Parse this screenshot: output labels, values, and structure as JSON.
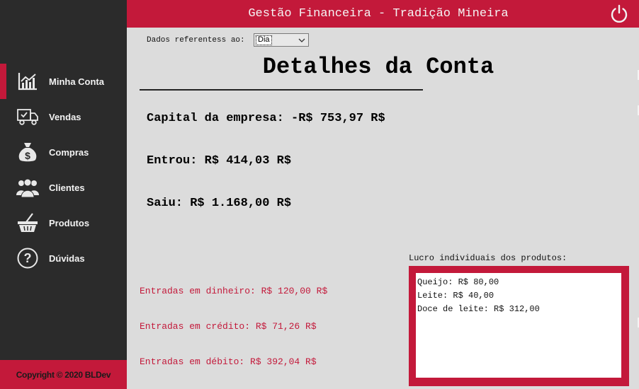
{
  "header": {
    "title": "Gestão Financeira - Tradição Mineira",
    "power_icon": "power-icon"
  },
  "sidebar": {
    "items": [
      {
        "label": "Minha Conta",
        "icon": "chart-icon",
        "active": true
      },
      {
        "label": "Vendas",
        "icon": "truck-icon",
        "active": false
      },
      {
        "label": "Compras",
        "icon": "money-bag-icon",
        "active": false
      },
      {
        "label": "Clientes",
        "icon": "users-icon",
        "active": false
      },
      {
        "label": "Produtos",
        "icon": "basket-icon",
        "active": false
      },
      {
        "label": "Dúvidas",
        "icon": "question-icon",
        "active": false
      }
    ],
    "footer": "Copyright © 2020 BLDev"
  },
  "main": {
    "period_label": "Dados referentess ao:",
    "period_value": "Dia",
    "title": "Detalhes da Conta",
    "capital": "Capital da empresa: -R$ 753,97 R$",
    "entrou": "Entrou: R$ 414,03 R$",
    "saiu": "Saiu: R$ 1.168,00 R$",
    "entradas": {
      "dinheiro": "Entradas em dinheiro: R$ 120,00 R$",
      "credito": "Entradas em crédito: R$ 71,26 R$",
      "debito": "Entradas em débito: R$ 392,04 R$"
    },
    "profit_label": "Lucro individuais dos produtos:",
    "profits": [
      "Queijo: R$ 80,00",
      "Leite: R$ 40,00",
      "Doce de leite: R$ 312,00"
    ]
  },
  "colors": {
    "accent": "#c3193a",
    "sidebar": "#2b2b2b",
    "background": "#dcdcdc"
  }
}
